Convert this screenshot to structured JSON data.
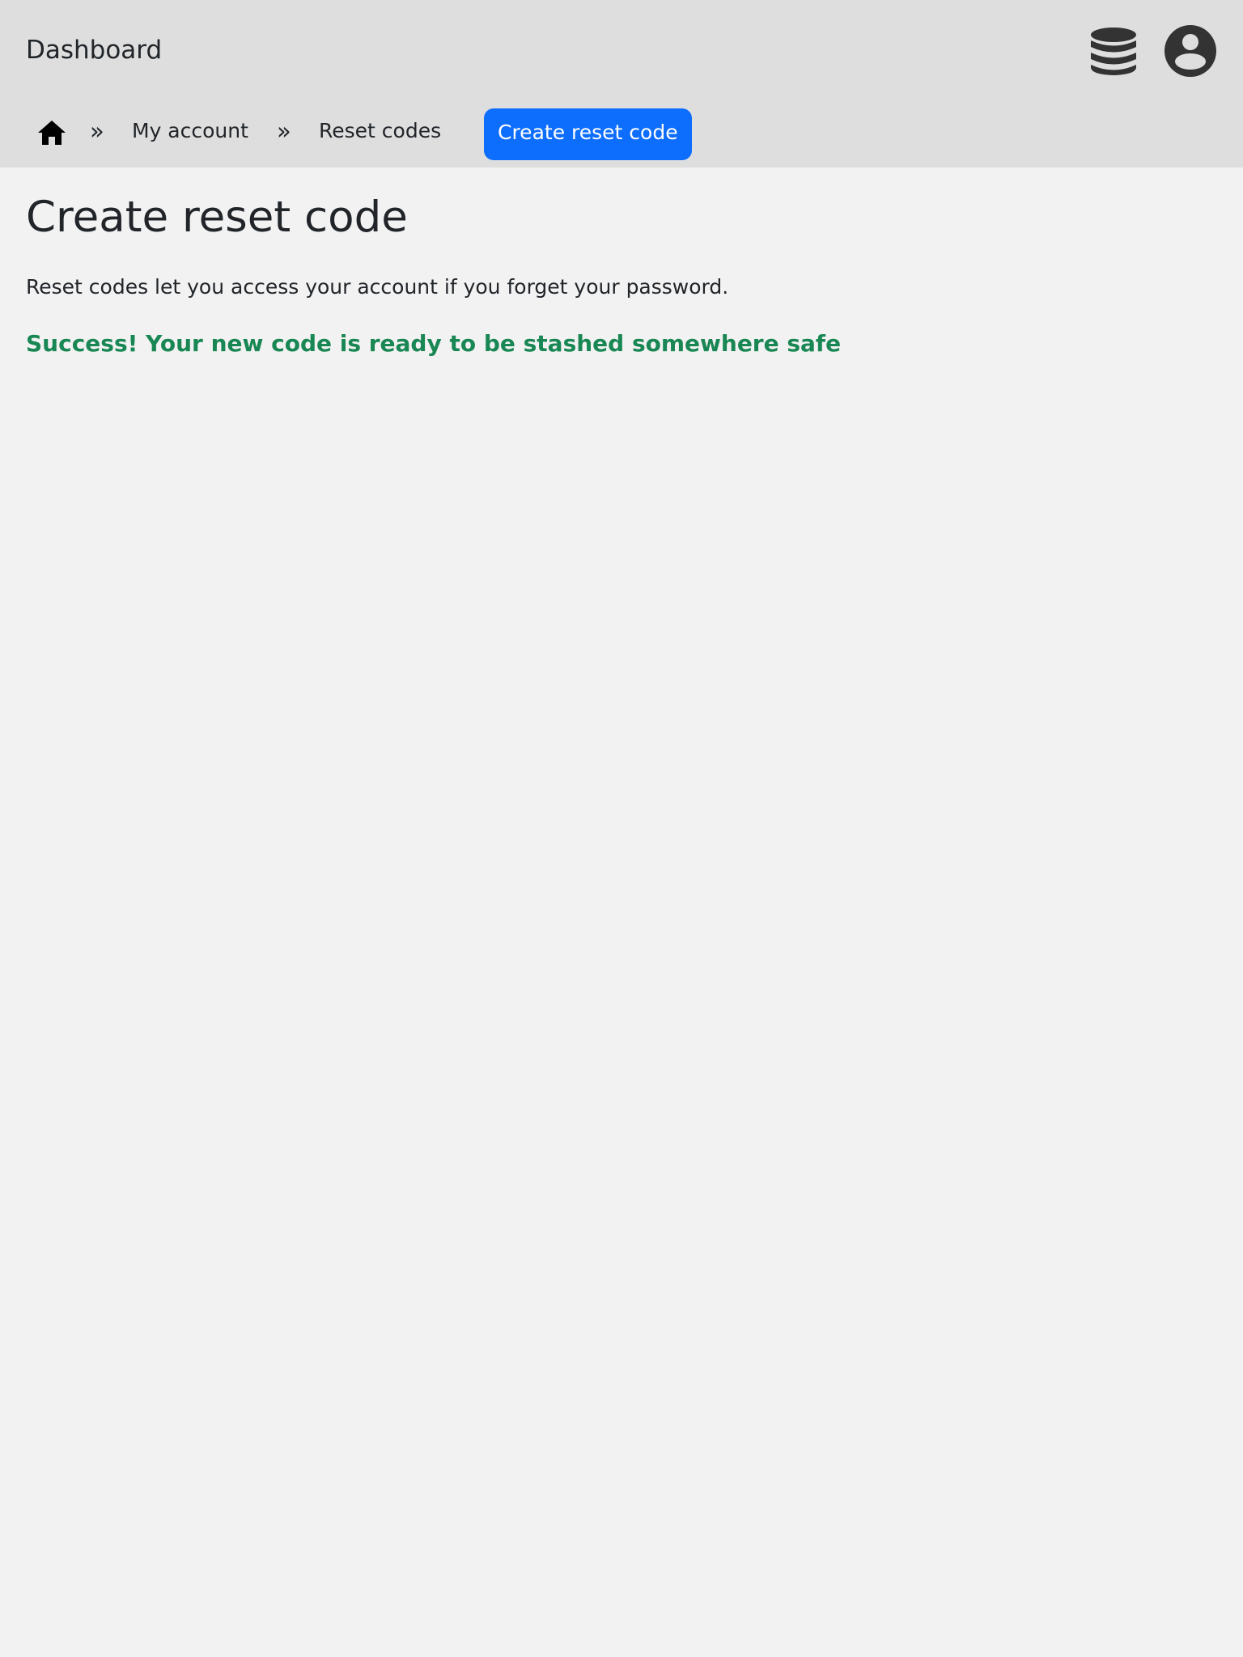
{
  "header": {
    "brand": "Dashboard",
    "icons": {
      "database": "database-icon",
      "account": "user-circle-icon"
    }
  },
  "breadcrumb": {
    "home_icon": "home-icon",
    "separator": "»",
    "items": [
      {
        "label": "My account"
      },
      {
        "label": "Reset codes"
      }
    ],
    "current": "Create reset code"
  },
  "main": {
    "title": "Create reset code",
    "intro": "Reset codes let you access your account if you forget your password.",
    "success_message": "Success! Your new code is ready to be stashed somewhere safe"
  },
  "colors": {
    "header_bg": "#dedede",
    "page_bg": "#f2f2f2",
    "accent": "#0d6efd",
    "success": "#198754",
    "icon": "#333333"
  }
}
